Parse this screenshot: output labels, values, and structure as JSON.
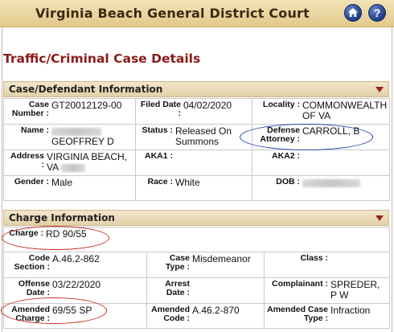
{
  "header": {
    "title": "Virginia Beach General District Court",
    "home_icon": "home-icon",
    "help_icon": "help-icon",
    "help_glyph": "?"
  },
  "page": {
    "title": "Traffic/Criminal Case Details"
  },
  "case_section": {
    "title": "Case/Defendant Information",
    "case_number_label": "Case Number :",
    "case_number": "GT20012129-00",
    "filed_label": "Filed Date :",
    "filed": "04/02/2020",
    "locality_label": "Locality :",
    "locality": "COMMONWEALTH OF VA",
    "name_label": "Name :",
    "name": "GEOFFREY D",
    "status_label": "Status :",
    "status": "Released On Summons",
    "defense_label": "Defense Attorney :",
    "defense": "CARROLL, B",
    "address_label": "Address :",
    "address": "VIRGINIA BEACH, VA",
    "aka1_label": "AKA1 :",
    "aka1": "",
    "aka2_label": "AKA2 :",
    "aka2": "",
    "gender_label": "Gender :",
    "gender": "Male",
    "race_label": "Race :",
    "race": "White",
    "dob_label": "DOB :",
    "dob": ""
  },
  "charge_section": {
    "title": "Charge Information",
    "charge_label": "Charge :",
    "charge": "RD 90/55",
    "code_section_label": "Code Section :",
    "code_section": "A.46.2-862",
    "case_type_label": "Case Type :",
    "case_type": "Misdemeanor",
    "class_label": "Class :",
    "class": "",
    "offense_date_label": "Offense Date :",
    "offense_date": "03/22/2020",
    "arrest_date_label": "Arrest Date :",
    "arrest_date": "",
    "complainant_label": "Complainant :",
    "complainant": "SPREDER, P W",
    "amended_charge_label": "Amended Charge :",
    "amended_charge": "69/55 SP",
    "amended_code_label": "Amended Code :",
    "amended_code": "A.46.2-870",
    "amended_case_type_label": "Amended Case Type :",
    "amended_case_type": "Infraction"
  },
  "annotations": {
    "red": "#c7321f",
    "blue": "#1d3fa8"
  }
}
